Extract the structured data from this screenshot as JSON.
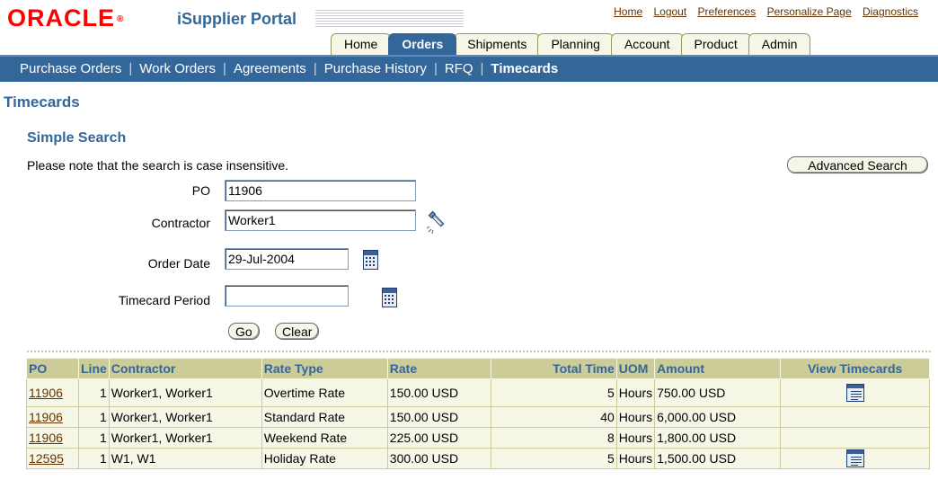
{
  "header": {
    "logo_text": "ORACLE",
    "logo_tm": "®",
    "portal_name": "iSupplier Portal",
    "global_links": [
      "Home",
      "Logout",
      "Preferences",
      "Personalize Page",
      "Diagnostics"
    ]
  },
  "tabs": [
    {
      "label": "Home",
      "active": false
    },
    {
      "label": "Orders",
      "active": true
    },
    {
      "label": "Shipments",
      "active": false
    },
    {
      "label": "Planning",
      "active": false
    },
    {
      "label": "Account",
      "active": false
    },
    {
      "label": "Product",
      "active": false
    },
    {
      "label": "Admin",
      "active": false
    }
  ],
  "subnav": {
    "items": [
      "Purchase Orders",
      "Work Orders",
      "Agreements",
      "Purchase History",
      "RFQ"
    ],
    "current": "Timecards"
  },
  "page": {
    "title": "Timecards",
    "section_title": "Simple Search",
    "note": "Please note that the search is case insensitive.",
    "advanced_search_label": "Advanced Search"
  },
  "search": {
    "po_label": "PO",
    "po_value": "11906",
    "contractor_label": "Contractor",
    "contractor_value": "Worker1",
    "order_date_label": "Order Date",
    "order_date_value": "29-Jul-2004",
    "timecard_period_label": "Timecard Period",
    "timecard_period_value": "",
    "go_label": "Go",
    "clear_label": "Clear"
  },
  "results": {
    "columns": [
      "PO",
      "Line",
      "Contractor",
      "Rate Type",
      "Rate",
      "Total Time",
      "UOM",
      "Amount",
      "View Timecards"
    ],
    "rows": [
      {
        "po": "11906",
        "line": "1",
        "contractor": "Worker1, Worker1",
        "rate_type": "Overtime Rate",
        "rate": "150.00 USD",
        "total_time": "5",
        "uom": "Hours",
        "amount": "750.00 USD",
        "view_icon": true
      },
      {
        "po": "11906",
        "line": "1",
        "contractor": "Worker1, Worker1",
        "rate_type": "Standard Rate",
        "rate": "150.00 USD",
        "total_time": "40",
        "uom": "Hours",
        "amount": "6,000.00 USD",
        "view_icon": false
      },
      {
        "po": "11906",
        "line": "1",
        "contractor": "Worker1, Worker1",
        "rate_type": "Weekend Rate",
        "rate": "225.00 USD",
        "total_time": "8",
        "uom": "Hours",
        "amount": "1,800.00 USD",
        "view_icon": false
      },
      {
        "po": "12595",
        "line": "1",
        "contractor": "W1, W1",
        "rate_type": "Holiday Rate",
        "rate": "300.00 USD",
        "total_time": "5",
        "uom": "Hours",
        "amount": "1,500.00 USD",
        "view_icon": true
      }
    ]
  },
  "icons": {
    "search": "flashlight-icon",
    "calendar": "calendar-icon",
    "view": "view-timecard-icon"
  },
  "colors": {
    "brand_red": "#ff0000",
    "nav_blue": "#336699",
    "table_header": "#cccc99",
    "table_cell": "#f7f7e7",
    "link": "#663300"
  }
}
